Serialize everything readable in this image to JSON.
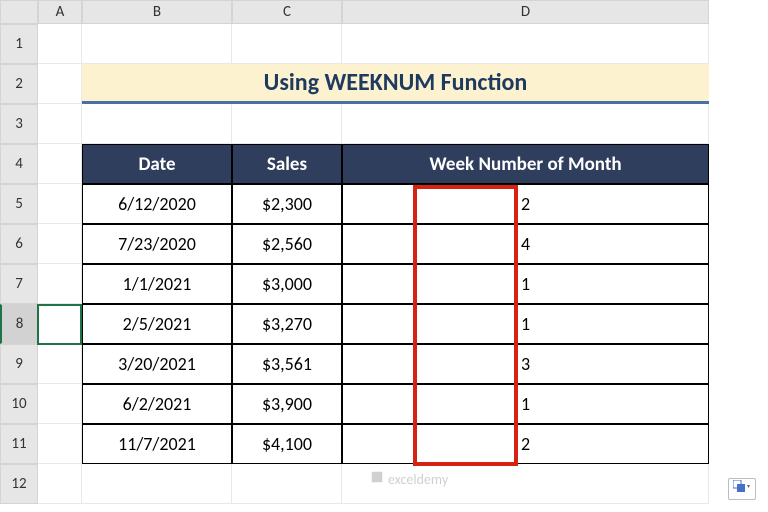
{
  "columns": [
    "A",
    "B",
    "C",
    "D"
  ],
  "rows": [
    "1",
    "2",
    "3",
    "4",
    "5",
    "6",
    "7",
    "8",
    "9",
    "10",
    "11",
    "12"
  ],
  "selected_row_index": 7,
  "title": "Using WEEKNUM Function",
  "table": {
    "headers": {
      "date": "Date",
      "sales": "Sales",
      "week": "Week Number of Month"
    },
    "rows": [
      {
        "date": "6/12/2020",
        "sales": "$2,300",
        "week": "2"
      },
      {
        "date": "7/23/2020",
        "sales": "$2,560",
        "week": "4"
      },
      {
        "date": "1/1/2021",
        "sales": "$3,000",
        "week": "1"
      },
      {
        "date": "2/5/2021",
        "sales": "$3,270",
        "week": "1"
      },
      {
        "date": "3/20/2021",
        "sales": "$3,561",
        "week": "3"
      },
      {
        "date": "6/2/2021",
        "sales": "$3,900",
        "week": "1"
      },
      {
        "date": "11/7/2021",
        "sales": "$4,100",
        "week": "2"
      }
    ]
  },
  "watermark": "exceldemy",
  "icons": {
    "fill": "auto-fill-options-icon",
    "logo": "exceldemy-logo-icon"
  },
  "chart_data": {
    "type": "table",
    "title": "Using WEEKNUM Function",
    "columns": [
      "Date",
      "Sales",
      "Week Number of Month"
    ],
    "rows": [
      [
        "6/12/2020",
        2300,
        2
      ],
      [
        "7/23/2020",
        2560,
        4
      ],
      [
        "1/1/2021",
        3000,
        1
      ],
      [
        "2/5/2021",
        3270,
        1
      ],
      [
        "3/20/2021",
        3561,
        3
      ],
      [
        "6/2/2021",
        3900,
        1
      ],
      [
        "11/7/2021",
        4100,
        2
      ]
    ]
  }
}
